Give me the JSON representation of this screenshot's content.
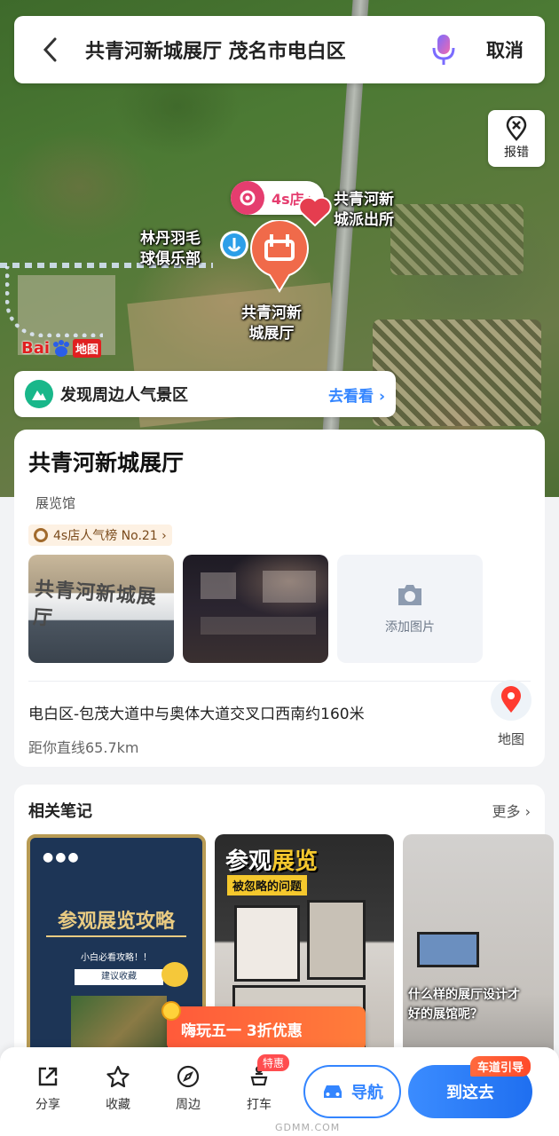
{
  "search": {
    "query": "共青河新城展厅 茂名市电白区",
    "cancel_label": "取消"
  },
  "map": {
    "report_label": "报错",
    "shop_tag": "4s店",
    "labels": {
      "police": "共青河新\n城派出所",
      "badminton": "林丹羽毛\n球俱乐部",
      "poi": "共青河新\n城展厅"
    },
    "logo": {
      "bai": "Bai",
      "ditu": "地图"
    },
    "discover": {
      "title": "发现周边人气景区",
      "action": "去看看 ›"
    }
  },
  "place": {
    "name": "共青河新城展厅",
    "category": "展览馆",
    "rank_tag": "4s店人气榜 No.21 ›",
    "photo1_sign": "共青河新城展厅",
    "add_photo_label": "添加图片",
    "address": "电白区-包茂大道中与奥体大道交叉口西南约160米",
    "distance": "距你直线65.7km",
    "map_label": "地图"
  },
  "notes": {
    "title": "相关笔记",
    "more": "更多 ›",
    "items": [
      {
        "dots": "●●●",
        "title": "参观展览攻略",
        "sub": "小白必看攻略！！",
        "tag": "建议收藏"
      },
      {
        "title_a": "参观",
        "title_b": "展览",
        "sub": "被忽略的问题"
      },
      {
        "text": "什么样的展厅设计才\n好的展馆呢？"
      }
    ]
  },
  "promo": {
    "text": "嗨玩五一 3折优惠"
  },
  "bottom": {
    "tabs": [
      "分享",
      "收藏",
      "周边",
      "打车"
    ],
    "taxi_badge": "特惠",
    "navigate": "导航",
    "go_here": "到这去",
    "lane_tag": "车道引导"
  },
  "watermark": "GDMM.COM",
  "colors": {
    "accent": "#3385ff",
    "pin": "#f06a4a",
    "shop": "#e53d6f"
  }
}
